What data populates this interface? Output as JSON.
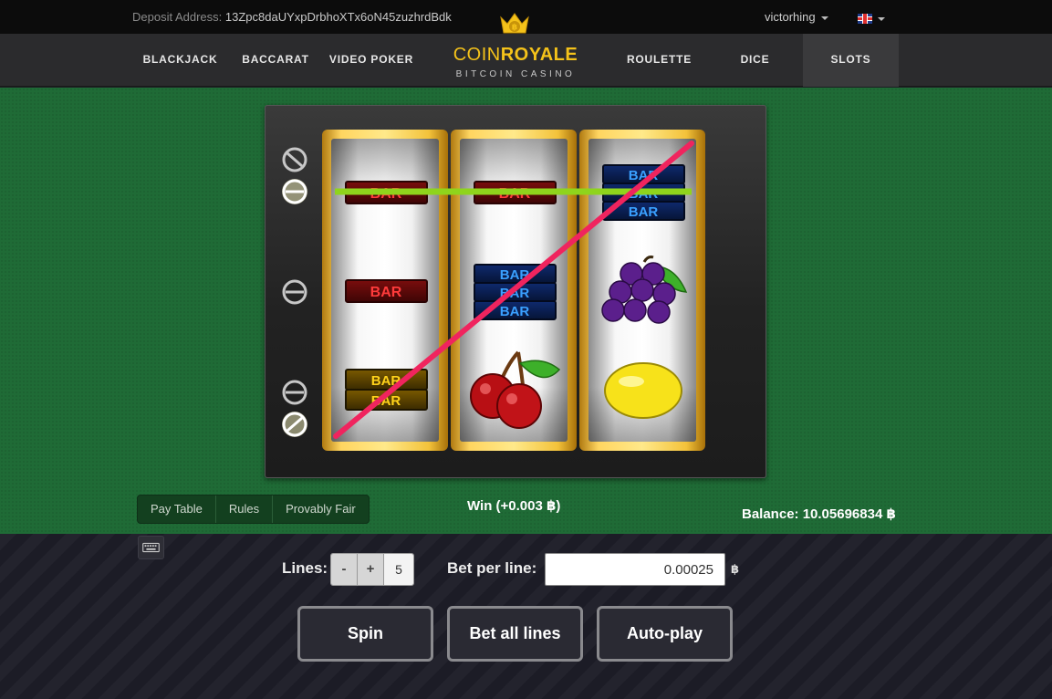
{
  "topbar": {
    "deposit_label": "Deposit Address:",
    "deposit_address": "13Zpc8daUYxpDrbhoXTx6oN45zuzhrdBdk",
    "username": "victorhing",
    "language_icon": "uk-flag-icon"
  },
  "nav": {
    "items": [
      {
        "label": "BLACKJACK"
      },
      {
        "label": "BACCARAT"
      },
      {
        "label": "VIDEO POKER"
      },
      {
        "label": "ROULETTE"
      },
      {
        "label": "DICE"
      },
      {
        "label": "SLOTS",
        "active": true
      }
    ],
    "logo": {
      "word_a": "COIN",
      "word_b": "ROYALE",
      "subtitle": "BITCOIN CASINO",
      "icon": "crown-icon"
    }
  },
  "reels": [
    [
      "BAR",
      "BAR",
      "BAR BAR"
    ],
    [
      "BAR",
      "BAR BAR BAR",
      "cherries"
    ],
    [
      "BAR BAR BAR",
      "grapes",
      "lemon"
    ]
  ],
  "symbol_labels": {
    "bar": "BAR"
  },
  "paylines": {
    "icons": [
      "line-indicator-diagonal-down",
      "line-indicator-top",
      "line-indicator-middle",
      "line-indicator-bottom",
      "line-indicator-diagonal-up"
    ],
    "active_colors": {
      "top": "#8fd41c",
      "diagonal": "#f0245e"
    }
  },
  "tabs": [
    "Pay Table",
    "Rules",
    "Provably Fair"
  ],
  "win_text": "Win (+0.003 ฿)",
  "balance_text": "Balance: 10.05696834 ฿",
  "controls": {
    "lines_label": "Lines:",
    "minus": "-",
    "plus": "+",
    "lines_value": "5",
    "bet_label": "Bet per line:",
    "bet_value": "0.00025",
    "currency": "฿",
    "spin": "Spin",
    "bet_all": "Bet all lines",
    "autoplay": "Auto-play"
  },
  "colors": {
    "felt": "#1f6b36",
    "gold": "#f4c21a"
  }
}
